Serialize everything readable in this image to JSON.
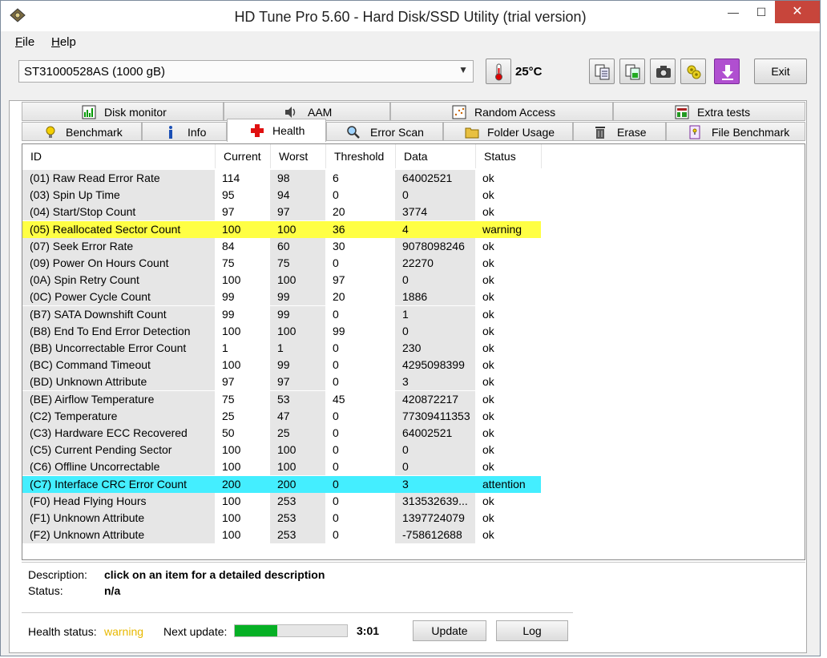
{
  "window": {
    "title": "HD Tune Pro 5.60 - Hard Disk/SSD Utility (trial version)",
    "min_glyph": "—",
    "max_glyph": "☐",
    "close_glyph": "✕"
  },
  "menu": [
    {
      "accel": "F",
      "rest": "ile"
    },
    {
      "accel": "H",
      "rest": "elp"
    }
  ],
  "toolbar": {
    "drive": "ST31000528AS (1000 gB)",
    "temperature": "25°C",
    "exit_label": "Exit"
  },
  "tabs_top": [
    "Disk monitor",
    "AAM",
    "Random Access",
    "Extra tests"
  ],
  "tabs_bottom": [
    "Benchmark",
    "Info",
    "Health",
    "Error Scan",
    "Folder Usage",
    "Erase",
    "File Benchmark"
  ],
  "active_tab": "Health",
  "columns": [
    "ID",
    "Current",
    "Worst",
    "Threshold",
    "Data",
    "Status"
  ],
  "rows": [
    {
      "id": "(01) Raw Read Error Rate",
      "current": "114",
      "worst": "98",
      "threshold": "6",
      "data": "64002521",
      "status": "ok",
      "level": "ok"
    },
    {
      "id": "(03) Spin Up Time",
      "current": "95",
      "worst": "94",
      "threshold": "0",
      "data": "0",
      "status": "ok",
      "level": "ok"
    },
    {
      "id": "(04) Start/Stop Count",
      "current": "97",
      "worst": "97",
      "threshold": "20",
      "data": "3774",
      "status": "ok",
      "level": "ok"
    },
    {
      "id": "(05) Reallocated Sector Count",
      "current": "100",
      "worst": "100",
      "threshold": "36",
      "data": "4",
      "status": "warning",
      "level": "warning"
    },
    {
      "id": "(07) Seek Error Rate",
      "current": "84",
      "worst": "60",
      "threshold": "30",
      "data": "9078098246",
      "status": "ok",
      "level": "ok"
    },
    {
      "id": "(09) Power On Hours Count",
      "current": "75",
      "worst": "75",
      "threshold": "0",
      "data": "22270",
      "status": "ok",
      "level": "ok"
    },
    {
      "id": "(0A) Spin Retry Count",
      "current": "100",
      "worst": "100",
      "threshold": "97",
      "data": "0",
      "status": "ok",
      "level": "ok"
    },
    {
      "id": "(0C) Power Cycle Count",
      "current": "99",
      "worst": "99",
      "threshold": "20",
      "data": "1886",
      "status": "ok",
      "level": "ok"
    },
    {
      "id": "(B7) SATA Downshift Count",
      "current": "99",
      "worst": "99",
      "threshold": "0",
      "data": "1",
      "status": "ok",
      "level": "ok"
    },
    {
      "id": "(B8) End To End Error Detection",
      "current": "100",
      "worst": "100",
      "threshold": "99",
      "data": "0",
      "status": "ok",
      "level": "ok"
    },
    {
      "id": "(BB) Uncorrectable Error Count",
      "current": "1",
      "worst": "1",
      "threshold": "0",
      "data": "230",
      "status": "ok",
      "level": "ok"
    },
    {
      "id": "(BC) Command Timeout",
      "current": "100",
      "worst": "99",
      "threshold": "0",
      "data": "4295098399",
      "status": "ok",
      "level": "ok"
    },
    {
      "id": "(BD) Unknown Attribute",
      "current": "97",
      "worst": "97",
      "threshold": "0",
      "data": "3",
      "status": "ok",
      "level": "ok"
    },
    {
      "id": "(BE) Airflow Temperature",
      "current": "75",
      "worst": "53",
      "threshold": "45",
      "data": "420872217",
      "status": "ok",
      "level": "ok"
    },
    {
      "id": "(C2) Temperature",
      "current": "25",
      "worst": "47",
      "threshold": "0",
      "data": "77309411353",
      "status": "ok",
      "level": "ok"
    },
    {
      "id": "(C3) Hardware ECC Recovered",
      "current": "50",
      "worst": "25",
      "threshold": "0",
      "data": "64002521",
      "status": "ok",
      "level": "ok"
    },
    {
      "id": "(C5) Current Pending Sector",
      "current": "100",
      "worst": "100",
      "threshold": "0",
      "data": "0",
      "status": "ok",
      "level": "ok"
    },
    {
      "id": "(C6) Offline Uncorrectable",
      "current": "100",
      "worst": "100",
      "threshold": "0",
      "data": "0",
      "status": "ok",
      "level": "ok"
    },
    {
      "id": "(C7) Interface CRC Error Count",
      "current": "200",
      "worst": "200",
      "threshold": "0",
      "data": "3",
      "status": "attention",
      "level": "attention"
    },
    {
      "id": "(F0) Head Flying Hours",
      "current": "100",
      "worst": "253",
      "threshold": "0",
      "data": "313532639...",
      "status": "ok",
      "level": "ok"
    },
    {
      "id": "(F1) Unknown Attribute",
      "current": "100",
      "worst": "253",
      "threshold": "0",
      "data": "1397724079",
      "status": "ok",
      "level": "ok"
    },
    {
      "id": "(F2) Unknown Attribute",
      "current": "100",
      "worst": "253",
      "threshold": "0",
      "data": "-758612688",
      "status": "ok",
      "level": "ok"
    }
  ],
  "colors": {
    "warning_row": "#ffff44",
    "attention_row": "#44eeff",
    "warning_text": "#e8b800",
    "progress": "#06b025"
  },
  "description": {
    "label": "Description:",
    "value": "click on an item for a detailed description"
  },
  "status": {
    "label": "Status:",
    "value": "n/a"
  },
  "footer": {
    "health_label": "Health status:",
    "health_value": "warning",
    "next_update_label": "Next update:",
    "progress_fraction": 0.38,
    "countdown": "3:01",
    "update_label": "Update",
    "log_label": "Log"
  }
}
